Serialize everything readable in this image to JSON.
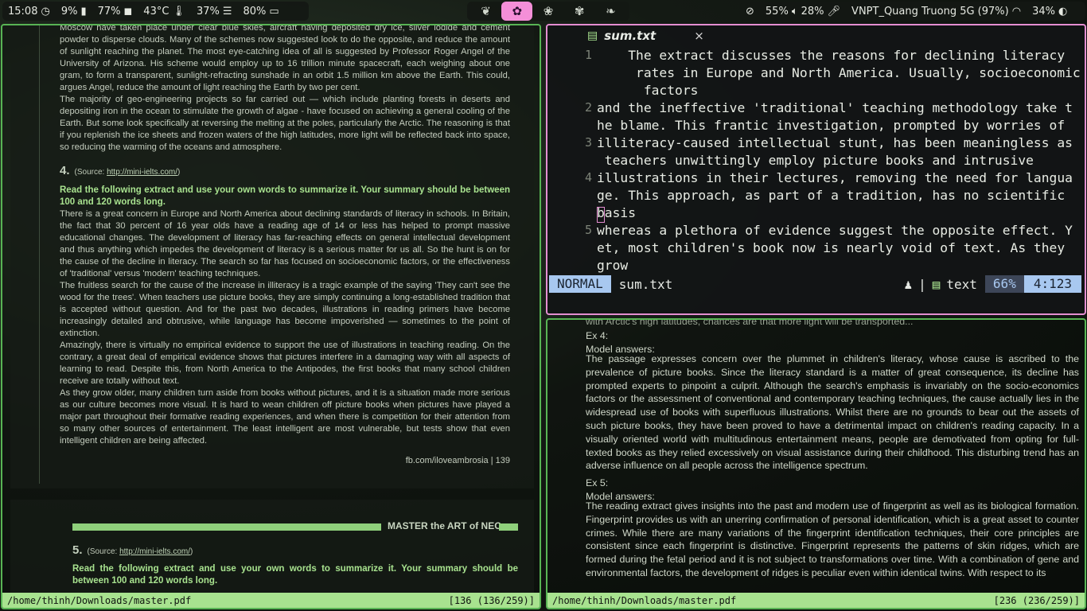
{
  "topbar": {
    "clock": "15:08",
    "cpu": "9%",
    "mem": "77%",
    "temp": "43°C",
    "disk": "37%",
    "battery_left": "80%",
    "volume": "55%",
    "mic": "28%",
    "wifi": "VNPT_Quang Truong 5G (97%)",
    "brightness": "34%",
    "workspaces": [
      {
        "icon": "leaf-icon",
        "glyph": "❦"
      },
      {
        "icon": "tulip-icon",
        "glyph": "✿",
        "active": true
      },
      {
        "icon": "flower-icon",
        "glyph": "❀"
      },
      {
        "icon": "rose-icon",
        "glyph": "✾"
      },
      {
        "icon": "sprout-icon",
        "glyph": "❧"
      }
    ]
  },
  "left_pdf": {
    "top_paragraphs": [
      "Moscow have taken place under clear blue skies, aircraft having deposited dry ice, silver iodide and cement powder to disperse clouds. Many of the schemes now suggested look to do the opposite, and reduce the amount of sunlight reaching the planet. The most eye-catching idea of all is suggested by Professor Roger Angel of the University of Arizona. His scheme would employ up to 16 trillion minute spacecraft, each weighing about one gram, to form a transparent, sunlight-refracting sunshade in an orbit 1.5 million km above the Earth. This could, argues Angel, reduce the amount of light reaching the Earth by two per cent.",
      "The majority of geo-engineering projects so far carried out — which include planting forests in deserts and depositing iron in the ocean to stimulate the growth of algae - have focused on achieving a general cooling of the Earth. But some look specifically at reversing the melting at the poles, particularly the Arctic. The reasoning is that if you replenish the ice sheets and frozen waters of the high latitudes, more light will be reflected back into space, so reducing the warming of the oceans and atmosphere."
    ],
    "ex4_num": "4.",
    "ex4_source_label": "(Source: ",
    "ex4_source_link": "http://mini-ielts.com/",
    "ex4_source_end": ")",
    "ex4_instruction": "Read the following extract and use your own words to summarize it. Your summary should be between 100 and 120 words long.",
    "ex4_paragraphs": [
      "There is a great concern in Europe and North America about declining standards of literacy in schools. In Britain, the fact that 30 percent of 16 year olds have a reading age of 14 or less has helped to prompt massive educational changes. The development of literacy has far-reaching effects on general intellectual development and thus anything which impedes the development of literacy is a serious matter for us all. So the hunt is on for the cause of the decline in literacy. The search so far has focused on socioeconomic factors, or the effectiveness of 'traditional' versus 'modern' teaching techniques.",
      "The fruitless search for the cause of the increase in illiteracy is a tragic example of the saying 'They can't see the wood for the trees'. When teachers use picture books, they are simply continuing a long-established tradition that is accepted without question. And for the past two decades, illustrations in reading primers have become increasingly detailed and obtrusive, while language has become impoverished — sometimes to the point of extinction.",
      "Amazingly, there is virtually no empirical evidence to support the use of illustrations in teaching reading. On the contrary, a great deal of empirical evidence shows that pictures interfere in a damaging way with all aspects of learning to read. Despite this, from North America to the Antipodes, the first books that many school children receive are totally without text.",
      "As they grow older, many children turn aside from books without pictures, and it is a situation made more serious as our culture becomes more visual. It is hard to wean children off picture books when pictures have played a major part throughout their formative reading experiences, and when there is competition for their attention from so many other sources of entertainment. The least intelligent are most vulnerable, but tests show that even intelligent children are being affected."
    ],
    "footer": "fb.com/iloveambrosia | 139",
    "page2_header": "MASTER the ART of NEC",
    "ex5_num": "5.",
    "ex5_source_label": "(Source: ",
    "ex5_source_link": "http://mini-ielts.com/",
    "ex5_source_end": ")",
    "ex5_instruction": "Read the following extract and use your own words to summarize it. Your summary should be between 100 and 120 words long.",
    "status_path": "/home/thinh/Downloads/master.pdf",
    "status_page": "[136 (136/259)]"
  },
  "editor": {
    "tab_name": "sum.txt",
    "close_glyph": "×",
    "lines": [
      {
        "n": "1",
        "rows": [
          "    The extract discusses the reasons for declining literacy",
          "     rates in Europe and North America. Usually, socioeconomic",
          "      factors"
        ]
      },
      {
        "n": "2",
        "rows": [
          "and the ineffective 'traditional' teaching methodology take t",
          "he blame. This frantic investigation, prompted by worries of"
        ]
      },
      {
        "n": "3",
        "rows": [
          "illiteracy-caused intellectual stunt, has been meaningless as",
          " teachers unwittingly employ picture books and intrusive"
        ]
      },
      {
        "n": "4",
        "rows": [
          "illustrations in their lectures, removing the need for langua",
          "ge. This approach, as part of a tradition, has no scientific",
          "basis"
        ]
      },
      {
        "n": "5",
        "rows": [
          "whereas a plethora of evidence suggest the opposite effect. Y",
          "et, most children's book now is nearly void of text. As they",
          "grow"
        ]
      }
    ],
    "mode": "NORMAL",
    "filename": "sum.txt",
    "os_glyph": "♟",
    "sep": "|",
    "filetype": "text",
    "percent": "66%",
    "position": "4:123"
  },
  "right_pdf": {
    "partial_top": "with Arctic's high latitudes, chances are that more light will be transported...",
    "ex4_label": "Ex 4:",
    "ex4_model": "Model answers:",
    "ex4_text": "The passage expresses concern over the plummet in children's literacy, whose cause is ascribed to the prevalence of picture books. Since the literacy standard is a matter of great consequence, its decline has prompted experts to pinpoint a culprit. Although the search's emphasis is invariably on the socio-economics factors or the assessment of conventional and contemporary teaching techniques, the cause actually lies in the widespread use of books with superfluous illustrations. Whilst there are no grounds to bear out the assets of such picture books, they have been proved to have a detrimental impact on children's reading capacity. In a visually oriented world with multitudinous entertainment means, people are demotivated from opting for full-texted books as they relied excessively on visual assistance during their childhood. This disturbing trend has an adverse influence on all people across the intelligence spectrum.",
    "ex5_label": "Ex 5:",
    "ex5_model": "Model answers:",
    "ex5_text": "The reading extract gives insights into the past and modern use of fingerprint as well as its biological formation. Fingerprint provides us with an unerring confirmation of personal identification, which is a great asset to counter crimes. While there are many variations of the fingerprint identification techniques, their core principles are consistent since each fingerprint is distinctive. Fingerprint represents the patterns of skin ridges, which are formed during the fetal period and it is not subject to transformations over time. With a combination of gene and environmental factors, the development of ridges is peculiar even within identical twins. With respect to its",
    "status_path": "/home/thinh/Downloads/master.pdf",
    "status_page": "[236 (236/259)]"
  }
}
